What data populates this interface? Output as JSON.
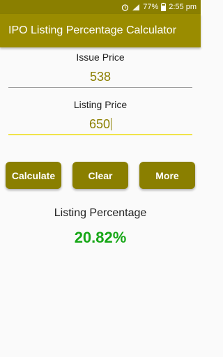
{
  "status_bar": {
    "battery": "77%",
    "time": "2:55 pm",
    "icons": [
      "alarm-icon",
      "signal-icon",
      "battery-icon"
    ]
  },
  "app_bar": {
    "title": "IPO Listing Percentage Calculator"
  },
  "form": {
    "issue_price_label": "Issue Price",
    "issue_price_value": "538",
    "listing_price_label": "Listing Price",
    "listing_price_value": "650"
  },
  "buttons": {
    "calculate": "Calculate",
    "clear": "Clear",
    "more": "More"
  },
  "result": {
    "label": "Listing Percentage",
    "value": "20.82%"
  },
  "colors": {
    "status_bar": "#8a7f00",
    "app_bar": "#9a8c00",
    "button": "#8a7f00",
    "result": "#17a717",
    "input_text": "#8c7f00"
  }
}
